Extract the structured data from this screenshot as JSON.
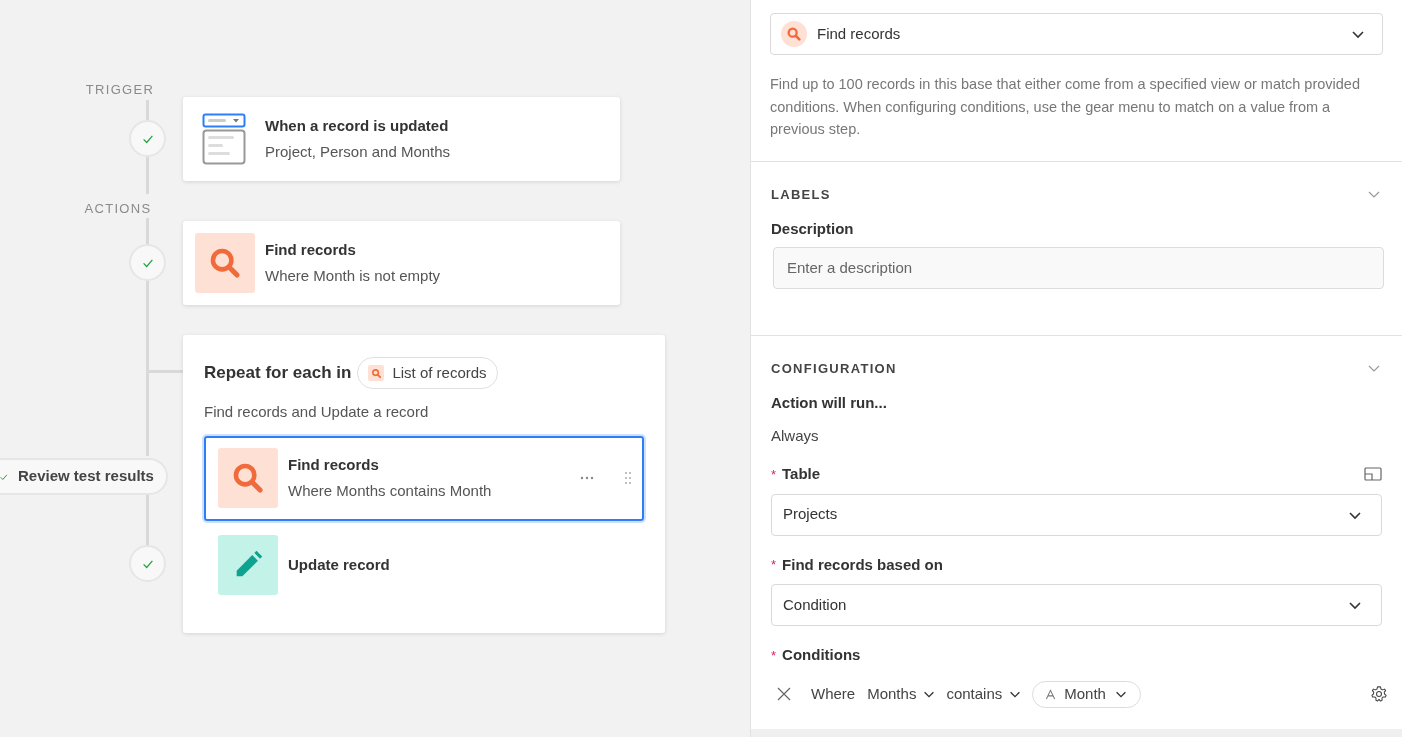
{
  "canvas": {
    "trigger_label": "TRIGGER",
    "actions_label": "ACTIONS",
    "trigger": {
      "kind": "record-updated",
      "title": "When a record is updated",
      "subtitle": "Project, Person and Months",
      "checked": true
    },
    "actions": [
      {
        "kind": "find",
        "title": "Find records",
        "subtitle": "Where Month is not empty",
        "checked": true
      },
      {
        "kind": "repeat",
        "title": "Repeat for each in",
        "source": "List of records",
        "summary": "Find records and Update a record",
        "checked": true,
        "steps": [
          {
            "kind": "find",
            "title": "Find records",
            "subtitle": "Where Months contains Month",
            "selected": true
          },
          {
            "kind": "update",
            "title": "Update record",
            "selected": false
          }
        ]
      }
    ],
    "review_button": "Review test results"
  },
  "panel": {
    "action_type": {
      "kind": "find",
      "value": "Find records"
    },
    "description": "Find up to 100 records in this base that either come from a specified view or match provided conditions. When configuring conditions, use the gear menu to match on a value from a previous step.",
    "labels": {
      "heading": "LABELS",
      "expanded": true,
      "description_label": "Description",
      "description_placeholder": "Enter a description"
    },
    "configuration": {
      "heading": "CONFIGURATION",
      "expanded": true,
      "run_label": "Action will run...",
      "run_value": "Always",
      "table": {
        "marker": "*",
        "label": "Table",
        "value": "Projects"
      },
      "based_on": {
        "marker": "*",
        "label": "Find records based on",
        "value": "Condition"
      },
      "conditions": {
        "marker": "*",
        "label": "Conditions",
        "rows": [
          {
            "prefix": "Where",
            "field": "Months",
            "operator": "contains",
            "value": "Month"
          }
        ]
      }
    }
  }
}
